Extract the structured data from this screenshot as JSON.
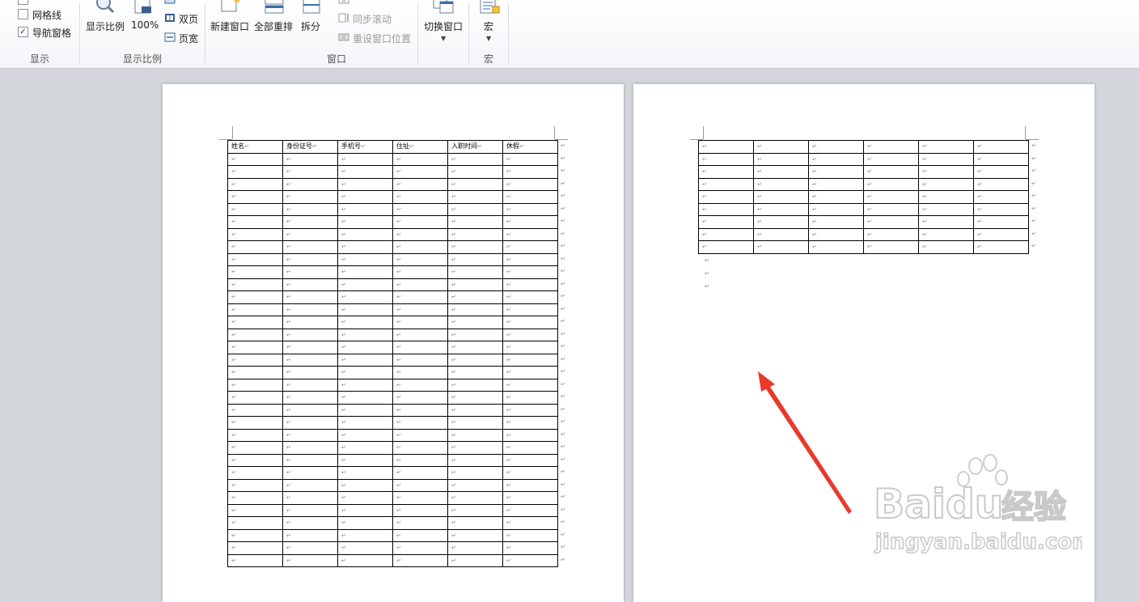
{
  "ribbon": {
    "show": {
      "gridlines_label": "网格线",
      "nav_pane_label": "导航窗格",
      "nav_pane_checked": "✓",
      "group_label": "显示"
    },
    "zoom": {
      "zoom_label": "显示比例",
      "percent_label": "100%",
      "two_page_label": "双页",
      "page_width_label": "页宽",
      "group_label": "显示比例"
    },
    "window": {
      "new_window_label": "新建窗口",
      "arrange_all_label": "全部重排",
      "split_label": "拆分",
      "sync_scroll_label": "同步滚动",
      "reset_position_label": "重设窗口位置",
      "switch_window_label": "切换窗口",
      "group_label": "窗口"
    },
    "macro": {
      "macro_label": "宏",
      "group_label": "宏"
    }
  },
  "page1": {
    "headers": [
      "姓名",
      "身份证号",
      "手机号",
      "住址",
      "入职时间",
      "休假"
    ],
    "cell_mark": "↵",
    "row_count": 34
  },
  "page2": {
    "cell_mark": "↵",
    "row_count": 9,
    "column_count": 6
  },
  "watermark": {
    "brand": "Baidu",
    "suffix": "经验",
    "url": "jingyan.baidu.com"
  },
  "colors": {
    "arrow": "#e8392c",
    "ribbon_bg": "#f3f5f8",
    "workspace_bg": "#d3d6da"
  }
}
